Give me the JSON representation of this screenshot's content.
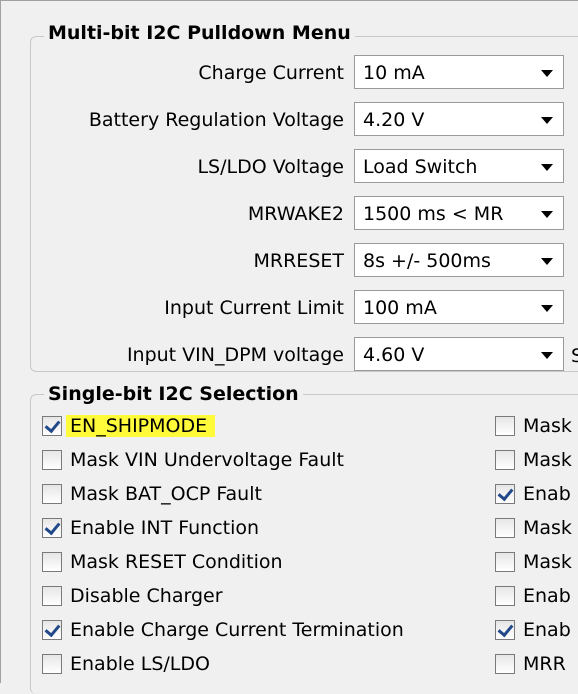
{
  "pulldown_group": {
    "title": "Multi-bit I2C Pulldown Menu",
    "rows": [
      {
        "label": "Charge Current",
        "value": "10 mA"
      },
      {
        "label": "Battery Regulation Voltage",
        "value": "4.20 V"
      },
      {
        "label": "LS/LDO Voltage",
        "value": "Load Switch"
      },
      {
        "label": "MRWAKE2",
        "value": "1500 ms < MR"
      },
      {
        "label": "MRRESET",
        "value": "8s +/- 500ms"
      },
      {
        "label": "Input Current Limit",
        "value": "100 mA"
      },
      {
        "label": "Input VIN_DPM voltage",
        "value": "4.60 V",
        "trailing_text": "S"
      }
    ]
  },
  "selection_group": {
    "title": "Single-bit I2C Selection",
    "left_checkboxes": [
      {
        "label": "EN_SHIPMODE",
        "checked": true,
        "highlighted": true
      },
      {
        "label": "Mask VIN Undervoltage Fault",
        "checked": false
      },
      {
        "label": "Mask BAT_OCP Fault",
        "checked": false
      },
      {
        "label": "Enable INT Function",
        "checked": true
      },
      {
        "label": "Mask RESET Condition",
        "checked": false
      },
      {
        "label": "Disable Charger",
        "checked": false
      },
      {
        "label": "Enable Charge Current Termination",
        "checked": true
      },
      {
        "label": "Enable LS/LDO",
        "checked": false
      }
    ],
    "right_checkboxes": [
      {
        "label": "Mask",
        "checked": false
      },
      {
        "label": "Mask",
        "checked": false
      },
      {
        "label": "Enab",
        "checked": true
      },
      {
        "label": "Mask",
        "checked": false
      },
      {
        "label": "Mask",
        "checked": false
      },
      {
        "label": "Enab",
        "checked": false
      },
      {
        "label": "Enab",
        "checked": true
      },
      {
        "label": "MRR",
        "checked": false
      }
    ]
  },
  "colors": {
    "highlight": "#fffb3a",
    "check": "#21498a",
    "background": "#f0f0f0"
  }
}
